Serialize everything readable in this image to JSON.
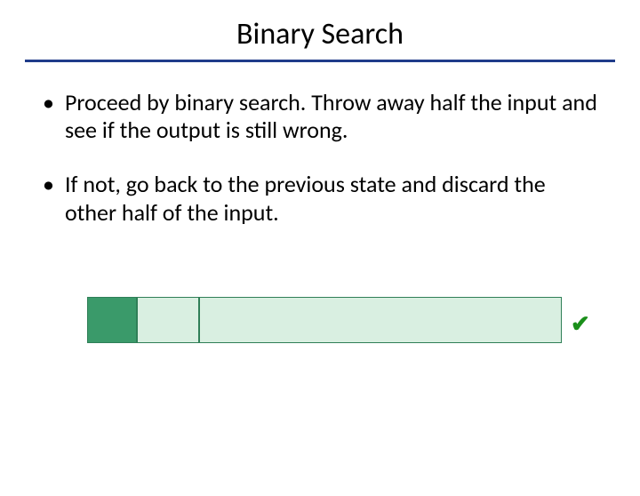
{
  "title": "Binary Search",
  "bullets": [
    "Proceed by binary search. Throw away half the input and see if the output is still wrong.",
    "If not, go back to the previous state and discard the other half of the input."
  ],
  "check_symbol": "✔"
}
